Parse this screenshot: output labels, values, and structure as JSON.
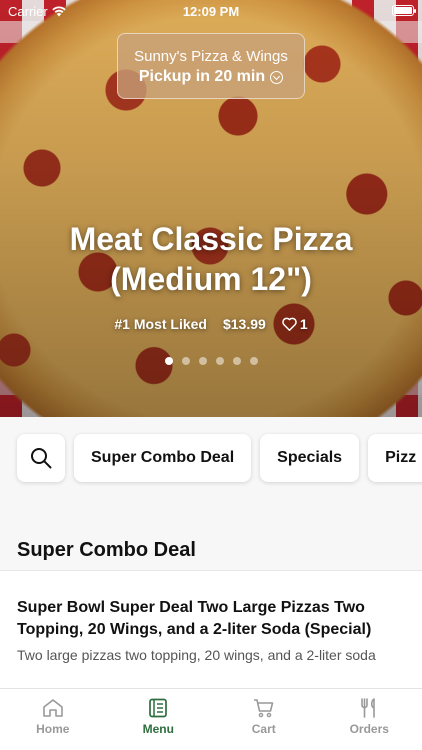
{
  "status_bar": {
    "carrier": "Carrier",
    "time": "12:09 PM"
  },
  "store": {
    "name": "Sunny's Pizza & Wings",
    "pickup": "Pickup in 20 min"
  },
  "hero": {
    "title_line1": "Meat Classic Pizza",
    "title_line2": "(Medium 12\")",
    "rank": "#1 Most Liked",
    "price": "$13.99",
    "likes": "1",
    "carousel_count": 6,
    "carousel_active": 1
  },
  "categories": [
    "Super Combo Deal",
    "Specials",
    "Pizz"
  ],
  "section": {
    "title": "Super Combo Deal"
  },
  "item": {
    "name": "Super Bowl Super Deal Two Large Pizzas Two Topping, 20 Wings, and a 2-liter Soda (Special)",
    "description": "Two large pizzas two topping, 20 wings, and a 2-liter soda"
  },
  "tabs": [
    {
      "label": "Home",
      "icon": "home-icon"
    },
    {
      "label": "Menu",
      "icon": "menu-icon"
    },
    {
      "label": "Cart",
      "icon": "cart-icon"
    },
    {
      "label": "Orders",
      "icon": "utensils-icon"
    }
  ],
  "colors": {
    "accent": "#2e6e3e",
    "inactive": "#999999"
  }
}
